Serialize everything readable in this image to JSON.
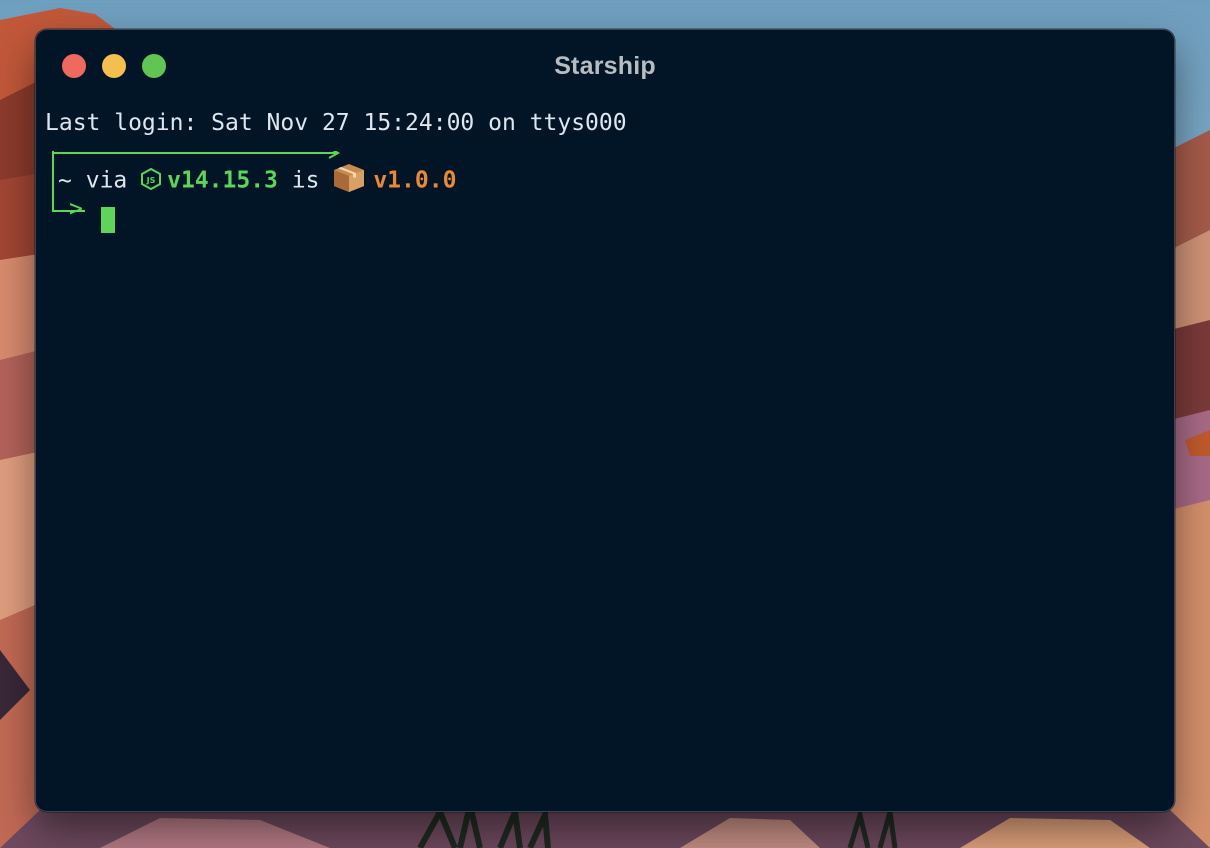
{
  "window": {
    "title": "Starship"
  },
  "terminal": {
    "last_login": "Last login: Sat Nov 27 15:24:00 on ttys000",
    "prompt": {
      "dir": "~",
      "via": "via",
      "node_icon": "nodejs-icon",
      "node_version": "v14.15.3",
      "is": "is",
      "package_icon": "package-box-icon",
      "package_version": "v1.0.0",
      "continuation_arrow": ">"
    }
  },
  "colors": {
    "terminal_bg": "#021526",
    "green": "#5cd55a",
    "orange": "#e8893a",
    "text": "#dfe6ee",
    "close": "#ee6a5f",
    "minimize": "#f5bf4f",
    "zoom": "#61c554"
  }
}
